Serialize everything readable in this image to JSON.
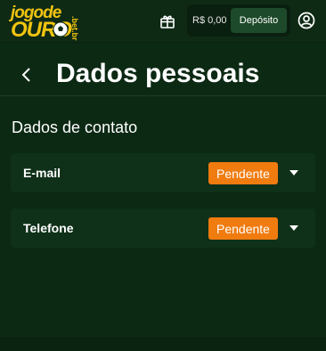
{
  "header": {
    "logo": {
      "top": "jogode",
      "bottom": "OURO",
      "tld": ".bet.br"
    },
    "gift_icon": "gift-icon",
    "balance": "R$ 0,00",
    "deposit_label": "Depósito",
    "user_icon": "user-circle-icon"
  },
  "page": {
    "back_icon": "chevron-left-icon",
    "title": "Dados pessoais"
  },
  "contact": {
    "section_title": "Dados de contato",
    "items": [
      {
        "label": "E-mail",
        "status": "Pendente",
        "expand_icon": "caret-down-icon"
      },
      {
        "label": "Telefone",
        "status": "Pendente",
        "expand_icon": "caret-down-icon"
      }
    ]
  },
  "colors": {
    "background": "#0c2914",
    "card": "#0f3119",
    "accent_gold": "#f1c40f",
    "pending_badge": "#f07b0f",
    "deposit_button": "#1d4a2a"
  }
}
